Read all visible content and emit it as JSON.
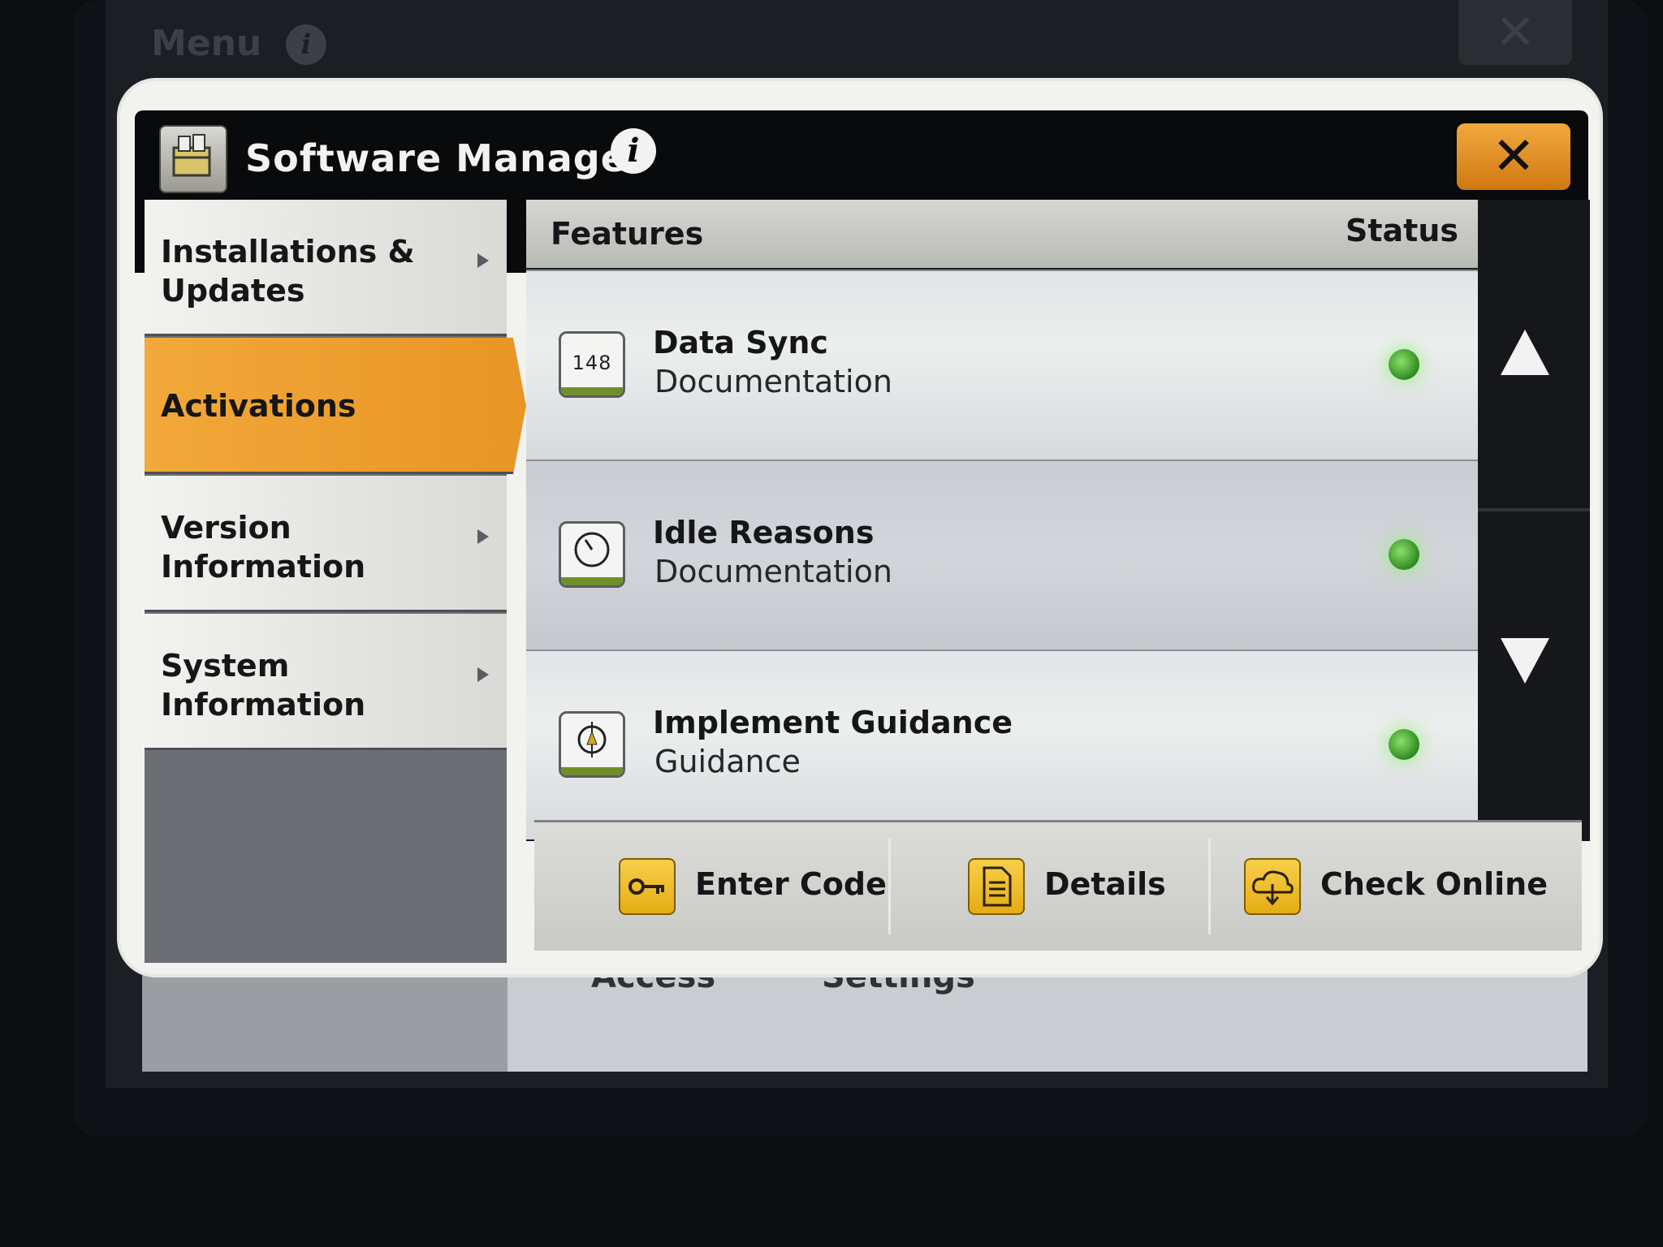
{
  "background": {
    "menu_label": "Menu",
    "bottom_tabs": [
      "Access",
      "Settings"
    ]
  },
  "dialog": {
    "title": "Software Manager",
    "close_glyph": "✕"
  },
  "nav": {
    "items": [
      {
        "label": "Installations & Updates",
        "active": false
      },
      {
        "label": "Activations",
        "active": true
      },
      {
        "label": "Version Information",
        "active": false
      },
      {
        "label": "System Information",
        "active": false
      }
    ]
  },
  "features": {
    "header_features": "Features",
    "header_status": "Status",
    "rows": [
      {
        "name": "Data Sync",
        "category": "Documentation",
        "icon": "data-sync-icon",
        "status_color": "#3fa82a"
      },
      {
        "name": "Idle Reasons",
        "category": "Documentation",
        "icon": "clock-icon",
        "status_color": "#3fa82a"
      },
      {
        "name": "Implement Guidance",
        "category": "Guidance",
        "icon": "guidance-icon",
        "status_color": "#3fa82a"
      }
    ]
  },
  "actions": {
    "enter_code": "Enter Code",
    "details": "Details",
    "check_online": "Check Online"
  },
  "colors": {
    "accent": "#e89524",
    "action_icon": "#f0c030"
  }
}
